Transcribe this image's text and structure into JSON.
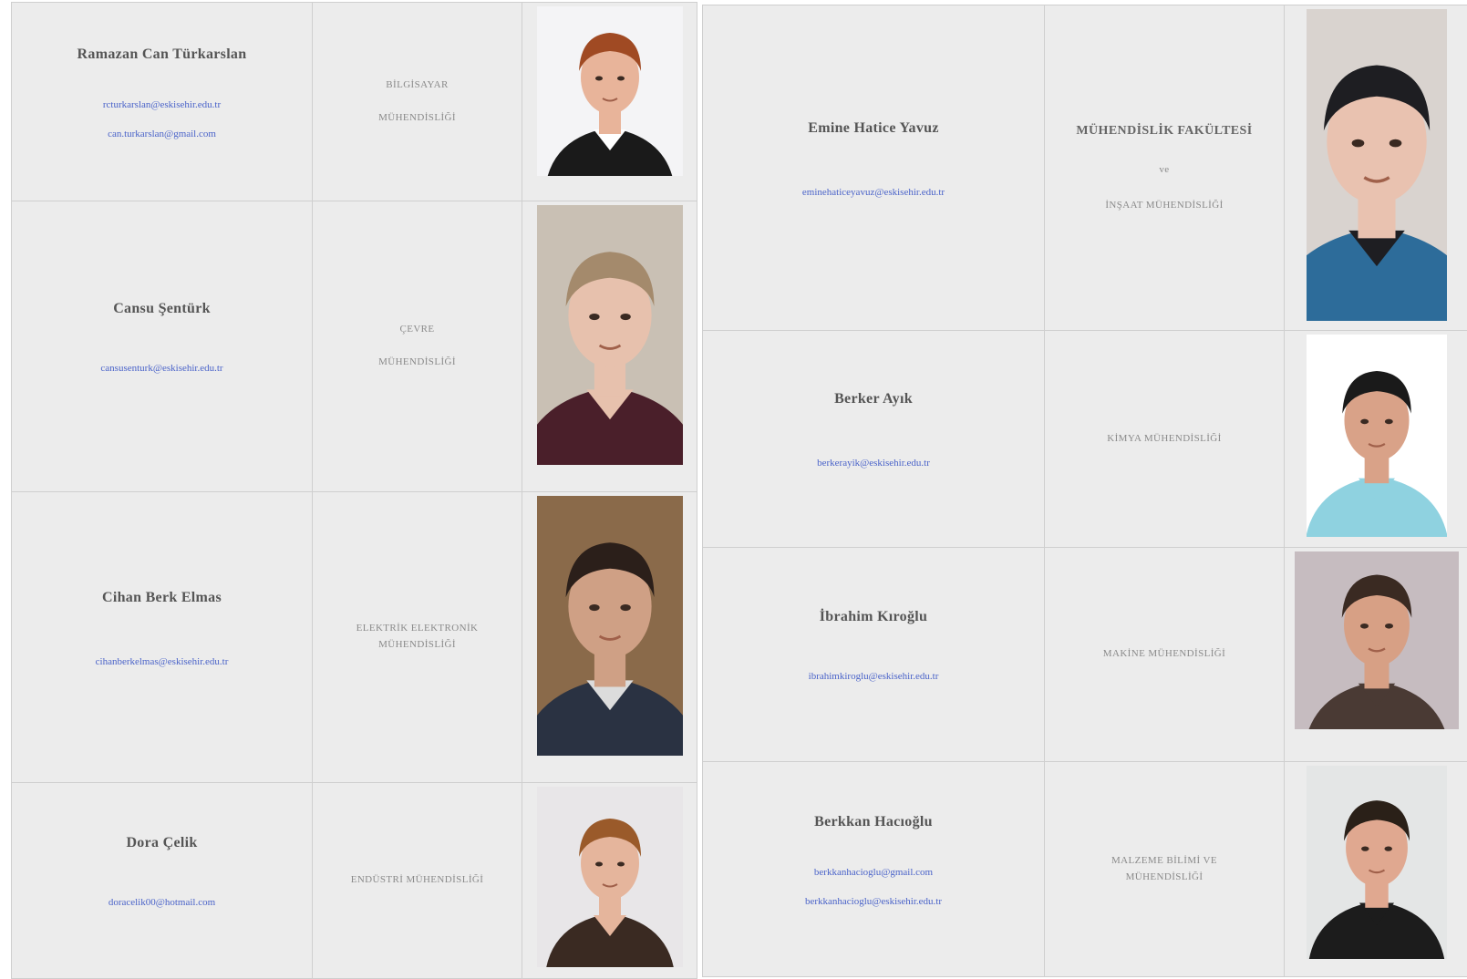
{
  "left": [
    {
      "name": "Ramazan Can Türkarslan",
      "emails": [
        "rcturkarslan@eskisehir.edu.tr",
        "can.turkarslan@gmail.com"
      ],
      "dept_lines": [
        "BİLGİSAYAR",
        "MÜHENDİSLİĞİ"
      ],
      "photo": {
        "bg": "#f4f4f6",
        "skin": "#e8b49a",
        "hair": "#a04a23",
        "shirt": "#1a1a1a",
        "collar": "#ffffff"
      }
    },
    {
      "name": "Cansu Şentürk",
      "emails": [
        "cansusenturk@eskisehir.edu.tr"
      ],
      "dept_lines": [
        "ÇEVRE",
        "MÜHENDİSLİĞİ"
      ],
      "photo": {
        "bg": "#c9c0b4",
        "skin": "#e7c1ad",
        "hair": "#a48a6c",
        "shirt": "#4a1f2a",
        "collar": "#e7c1ad"
      }
    },
    {
      "name": "Cihan Berk Elmas",
      "emails": [
        "cihanberkelmas@eskisehir.edu.tr"
      ],
      "dept_lines": [
        "ELEKTRİK ELEKTRONİK",
        "MÜHENDİSLİĞİ"
      ],
      "photo": {
        "bg": "#8a6a4a",
        "skin": "#cfa085",
        "hair": "#2b1f1a",
        "shirt": "#2a3242",
        "collar": "#dcdcdc"
      }
    },
    {
      "name": "Dora Çelik",
      "emails": [
        "doracelik00@hotmail.com"
      ],
      "dept_lines": [
        "ENDÜSTRİ MÜHENDİSLİĞİ"
      ],
      "photo": {
        "bg": "#e8e6e8",
        "skin": "#e5b59c",
        "hair": "#9a5a2a",
        "shirt": "#3a2a22",
        "collar": "#e5b59c"
      }
    }
  ],
  "right": [
    {
      "name": "Emine Hatice Yavuz",
      "emails": [
        "eminehaticeyavuz@eskisehir.edu.tr"
      ],
      "dept_lines": [
        "MÜHENDİSLİK FAKÜLTESİ",
        "ve",
        "İNŞAAT MÜHENDİSLİĞİ"
      ],
      "dept_bold_first": true,
      "photo": {
        "bg": "#d9d3cf",
        "skin": "#e9c2b0",
        "hair": "#1e1e22",
        "shirt": "#2d6c9a",
        "collar": "#1e1e22"
      }
    },
    {
      "name": "Berker Ayık",
      "emails": [
        "berkerayik@eskisehir.edu.tr"
      ],
      "dept_lines": [
        "KİMYA MÜHENDİSLİĞİ"
      ],
      "photo": {
        "bg": "#ffffff",
        "skin": "#d9a288",
        "hair": "#1a1a1a",
        "shirt": "#8fd2e0",
        "collar": "#8fd2e0"
      }
    },
    {
      "name": "İbrahim Kıroğlu",
      "emails": [
        "ibrahimkiroglu@eskisehir.edu.tr"
      ],
      "dept_lines": [
        "MAKİNE MÜHENDİSLİĞİ"
      ],
      "photo": {
        "bg": "#c6bcc0",
        "skin": "#d7a085",
        "hair": "#3a2a22",
        "shirt": "#4a3a34",
        "collar": "#4a3a34"
      }
    },
    {
      "name": "Berkkan Hacıoğlu",
      "emails": [
        "berkkanhacioglu@gmail.com",
        "berkkanhacioglu@eskisehir.edu.tr"
      ],
      "dept_lines": [
        "MALZEME BİLİMİ VE",
        "MÜHENDİSLİĞİ"
      ],
      "photo": {
        "bg": "#e4e6e6",
        "skin": "#e0a890",
        "hair": "#2a2018",
        "shirt": "#1c1c1c",
        "collar": "#1c1c1c"
      }
    }
  ]
}
